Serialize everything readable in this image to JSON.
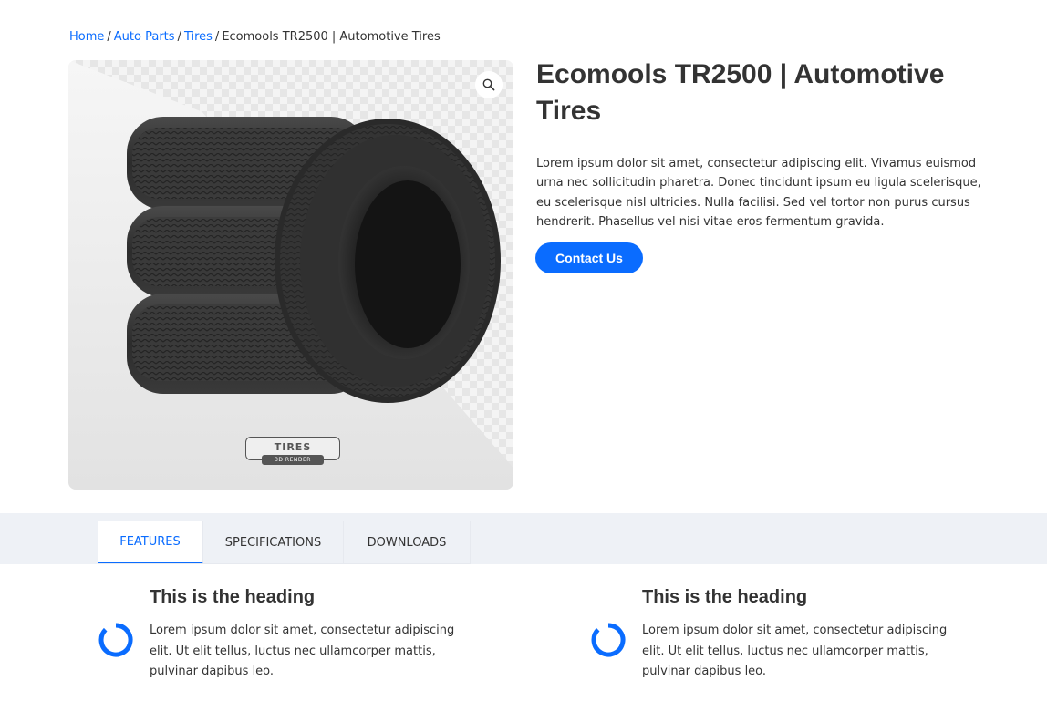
{
  "breadcrumb": {
    "items": [
      "Home",
      "Auto Parts",
      "Tires"
    ],
    "current": "Ecomools TR2500 | Automotive Tires",
    "separator": "/"
  },
  "product": {
    "title": "Ecomools TR2500 | Automotive Tires",
    "description": "Lorem ipsum dolor sit amet, consectetur adipiscing elit. Vivamus euismod urna nec sollicitudin pharetra. Donec tincidunt ipsum eu ligula scelerisque, eu scelerisque nisl ultricies. Nulla facilisi. Sed vel tortor non purus cursus hendrerit. Phasellus vel nisi vitae eros fermentum gravida.",
    "contact_label": "Contact Us",
    "image": {
      "badge_text": "TIRES",
      "badge_subtext": "3D RENDER",
      "zoom_icon": "search-icon"
    }
  },
  "tabs": [
    {
      "label": "FEATURES",
      "active": true
    },
    {
      "label": "SPECIFICATIONS",
      "active": false
    },
    {
      "label": "DOWNLOADS",
      "active": false
    }
  ],
  "features": [
    {
      "heading": "This is the heading",
      "text": "Lorem ipsum dolor sit amet, consectetur adipiscing elit. Ut elit tellus, luctus nec ullamcorper mattis, pulvinar dapibus leo.",
      "icon": "circle-notch-icon"
    },
    {
      "heading": "This is the heading",
      "text": "Lorem ipsum dolor sit amet, consectetur adipiscing elit. Ut elit tellus, luctus nec ullamcorper mattis, pulvinar dapibus leo.",
      "icon": "circle-notch-icon"
    }
  ],
  "colors": {
    "accent": "#0a6cff",
    "text": "#333333",
    "tab_band": "#eef1f6"
  }
}
